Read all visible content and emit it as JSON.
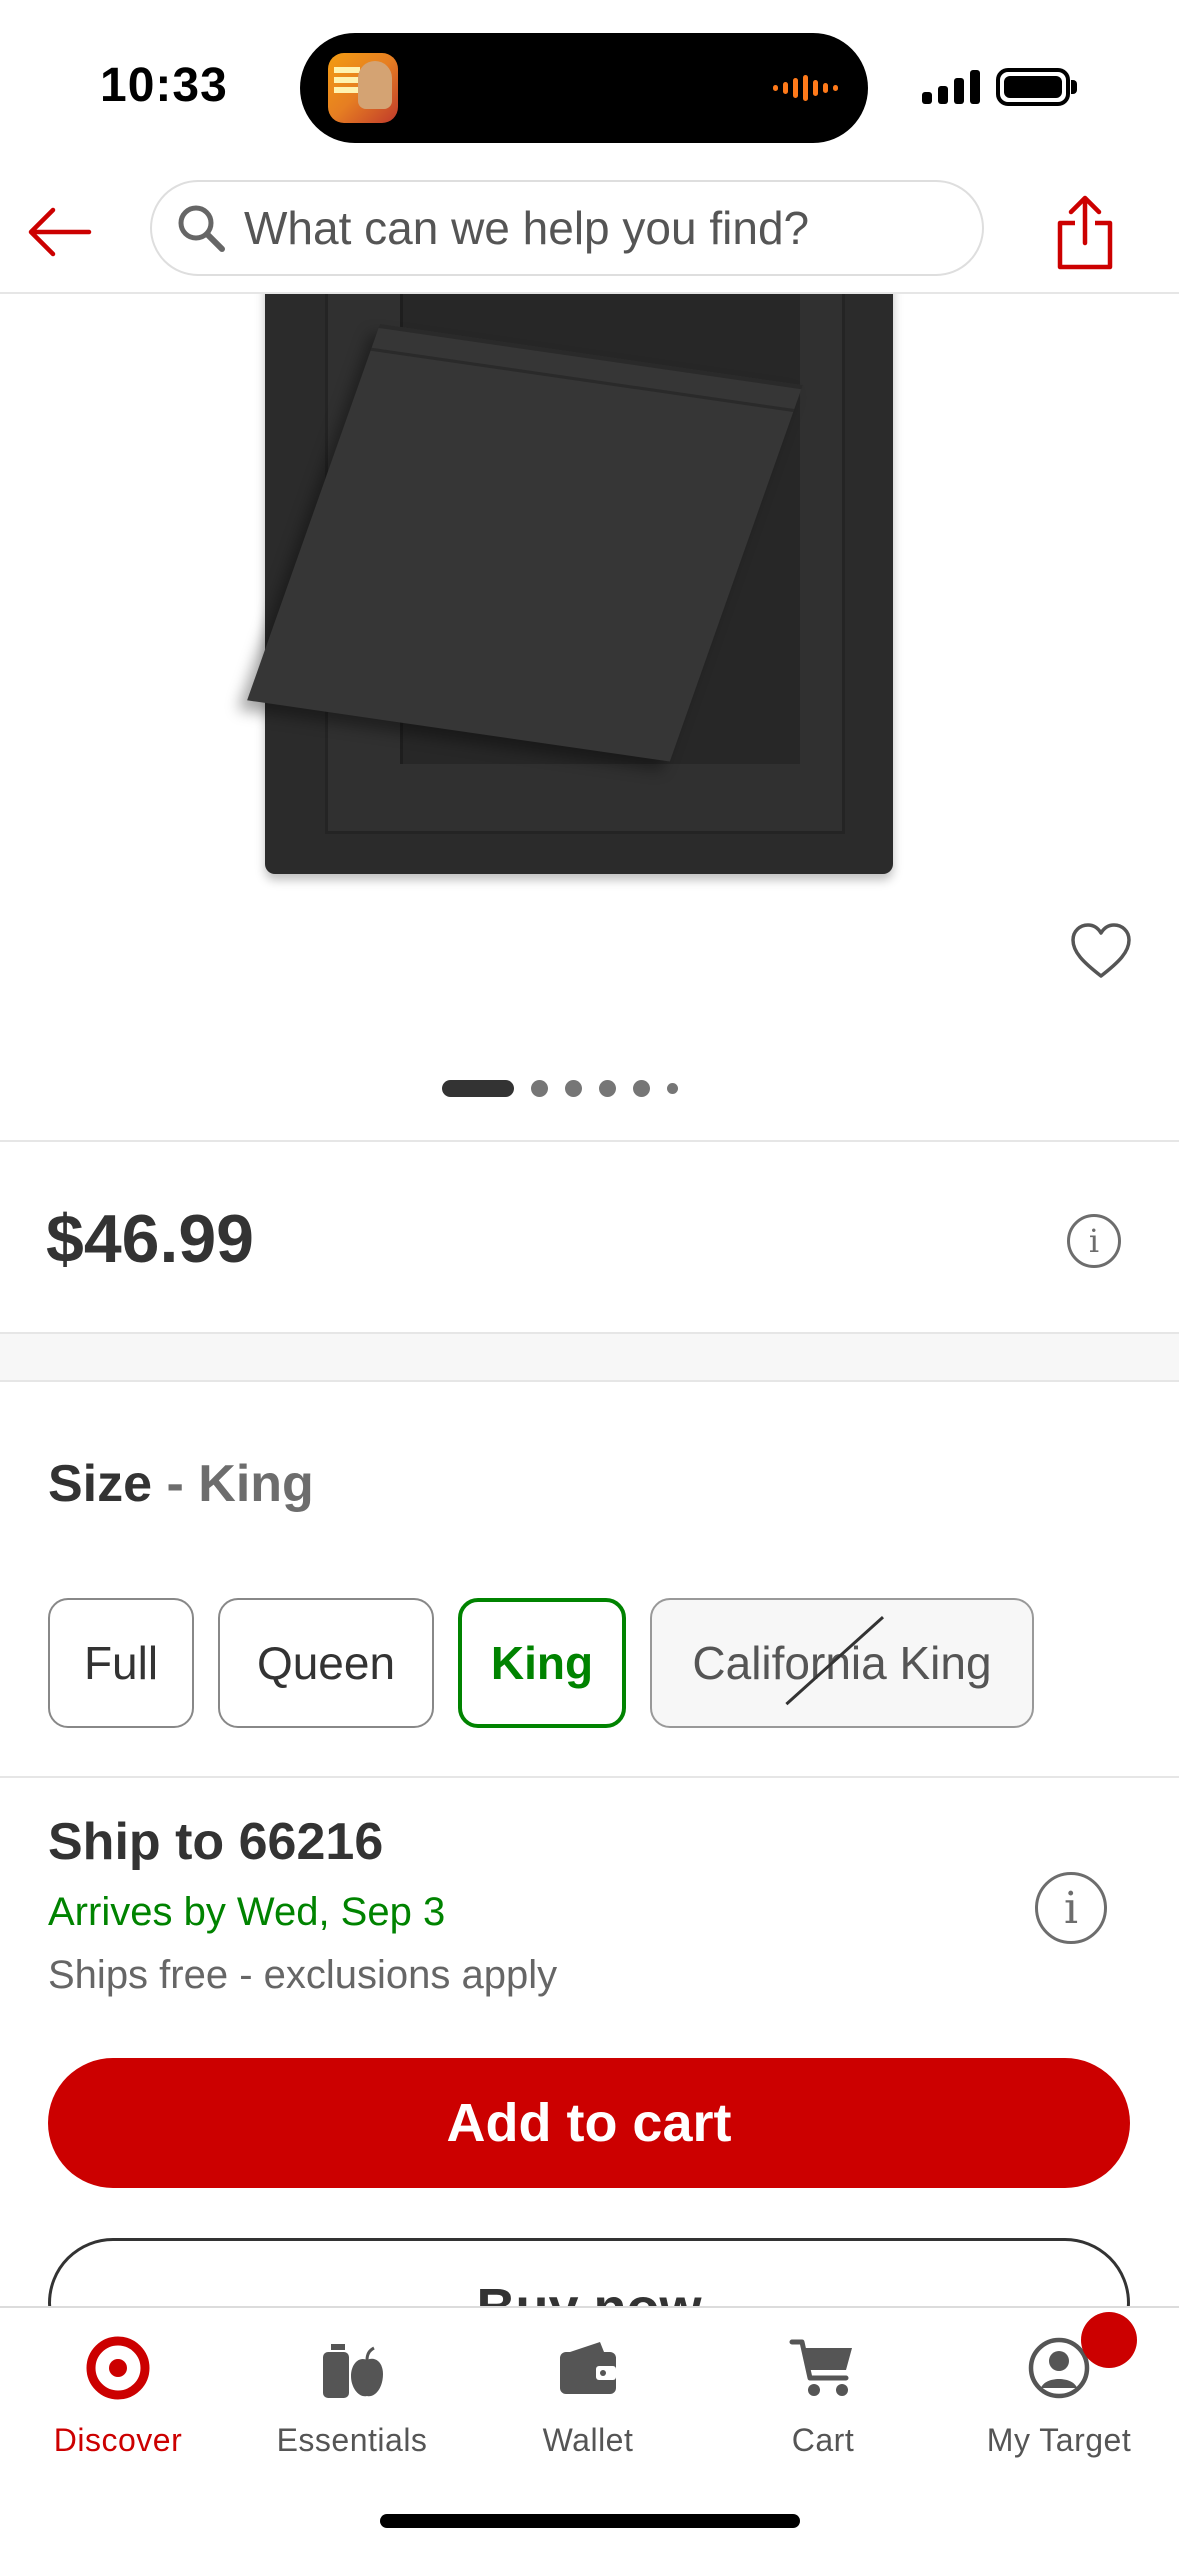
{
  "status_bar": {
    "time": "10:33"
  },
  "header": {
    "search_placeholder": "What can we help you find?",
    "icons": [
      "back-arrow-icon",
      "search-icon",
      "share-icon"
    ]
  },
  "gallery": {
    "image_count": 6,
    "active_index": 0
  },
  "product": {
    "price": "$46.99"
  },
  "size": {
    "label": "Size",
    "separator": " - ",
    "selected": "King",
    "options": [
      {
        "label": "Full",
        "state": "default"
      },
      {
        "label": "Queen",
        "state": "default"
      },
      {
        "label": "King",
        "state": "selected"
      },
      {
        "label": "California King",
        "state": "unavailable"
      }
    ]
  },
  "shipping": {
    "title": "Ship to 66216",
    "arrives": "Arrives by Wed, Sep 3",
    "note": "Ships free - exclusions apply"
  },
  "actions": {
    "add_to_cart": "Add to cart",
    "buy_now": "Buy now"
  },
  "tab_bar": {
    "tabs": [
      {
        "label": "Discover",
        "icon": "target-bullseye-icon",
        "active": true
      },
      {
        "label": "Essentials",
        "icon": "essentials-icon",
        "active": false
      },
      {
        "label": "Wallet",
        "icon": "wallet-icon",
        "active": false
      },
      {
        "label": "Cart",
        "icon": "cart-icon",
        "active": false
      },
      {
        "label": "My Target",
        "icon": "account-icon",
        "active": false
      }
    ]
  },
  "colors": {
    "brand_red": "#cc0000",
    "selected_green": "#008300",
    "text_dark": "#333333"
  }
}
